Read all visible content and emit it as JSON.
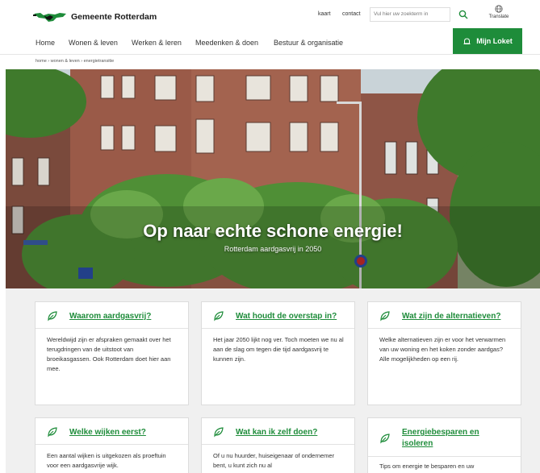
{
  "header": {
    "logo_text": "Gemeente Rotterdam",
    "links": [
      "kaart",
      "contact"
    ],
    "search_placeholder": "Vul hier uw zoekterm in",
    "translate_label": "Translate"
  },
  "nav": {
    "items": [
      "Home",
      "Wonen & leven",
      "Werken & leren",
      "Meedenken & doen",
      "Bestuur & organisatie"
    ],
    "loket_label": "Mijn Loket"
  },
  "breadcrumb": "home › wonen & leven › energietransitie",
  "hero": {
    "title": "Op naar echte schone energie!",
    "subtitle": "Rotterdam aardgasvrij in 2050"
  },
  "cards": [
    {
      "title": "Waarom aardgasvrij?",
      "body": "Wereldwijd zijn er afspraken gemaakt over het terugdringen van de uitstoot van broeikasgassen. Ook Rotterdam doet hier aan mee."
    },
    {
      "title": "Wat houdt de overstap in?",
      "body": "Het jaar 2050 lijkt nog ver. Toch moeten we nu al aan de slag om tegen die tijd aardgasvrij te kunnen zijn."
    },
    {
      "title": "Wat zijn de alternatieven?",
      "body": "Welke alternatieven zijn er voor het verwarmen van uw woning en het koken zonder aardgas? Alle mogelijkheden op een rij."
    },
    {
      "title": "Welke wijken eerst?",
      "body": "Een aantal wijken is uitgekozen als proeftuin voor een aardgasvrije wijk."
    },
    {
      "title": "Wat kan ik zelf doen?",
      "body": "Of u nu huurder, huiseigenaar of ondernemer bent, u kunt zich nu al"
    },
    {
      "title_line1": "Energiebesparen en",
      "title_line2": "isoleren",
      "body": "Tips om energie te besparen en uw"
    }
  ],
  "colors": {
    "accent": "#1e8c3a"
  }
}
